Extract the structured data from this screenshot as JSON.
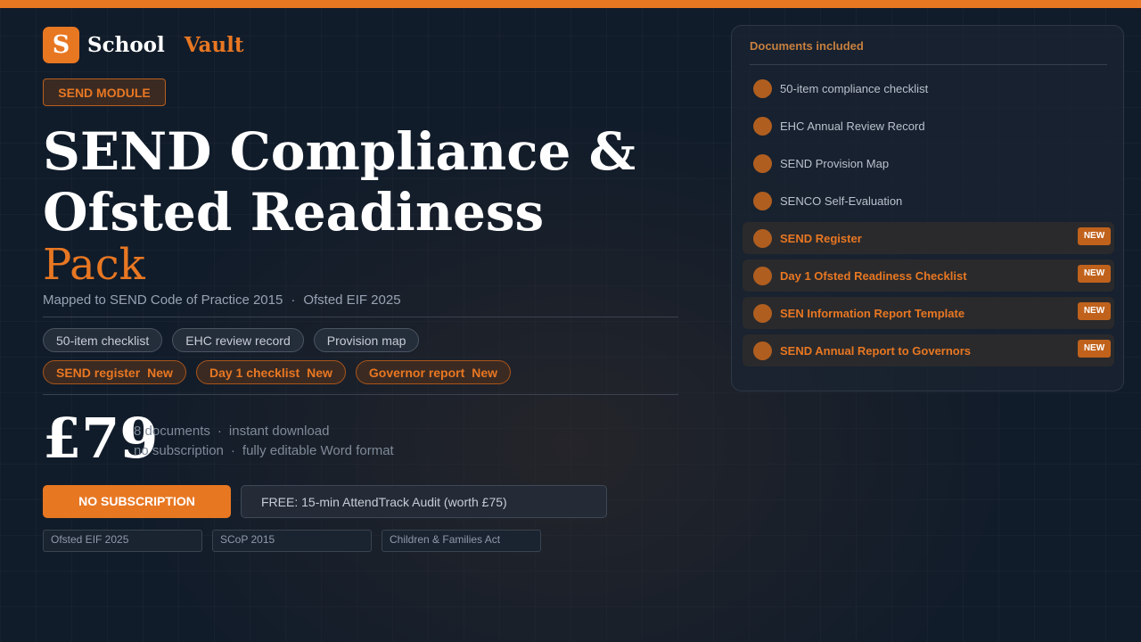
{
  "brand": {
    "logo_letter": "S",
    "name": "School",
    "accent": "Vault"
  },
  "module_badge": "SEND MODULE",
  "title": {
    "line1": "SEND Compliance &",
    "line2": "Ofsted Readiness",
    "accent": "Pack"
  },
  "mapped": {
    "part1": "Mapped to SEND Code of Practice 2015",
    "separator": "·",
    "part2": "Ofsted EIF 2025"
  },
  "chips_standard": [
    {
      "label": "50-item checklist"
    },
    {
      "label": "EHC review record"
    },
    {
      "label": "Provision map"
    }
  ],
  "chips_new": [
    {
      "label": "SEND register",
      "icon": "",
      "tag": "New"
    },
    {
      "label": "Day 1 checklist",
      "icon": "",
      "tag": "New"
    },
    {
      "label": "Governor report",
      "icon": "",
      "tag": "New"
    }
  ],
  "price": {
    "amount": "£79",
    "line1_a": "8 documents",
    "line1_b": "instant download",
    "line2_a": "no subscription",
    "line2_b": "fully editable Word format",
    "separator": "·"
  },
  "cta_label": "NO SUBSCRIPTION",
  "audit": {
    "icon": "",
    "label": "FREE: 15-min AttendTrack Audit (worth £75)"
  },
  "ref_tags": [
    "Ofsted EIF 2025",
    "SCoP 2015",
    "Children & Families Act"
  ],
  "panel": {
    "title": "Documents included",
    "documents": [
      {
        "label": "50-item compliance checklist",
        "icon": "",
        "is_new": false
      },
      {
        "label": "EHC Annual Review Record",
        "icon": "",
        "is_new": false
      },
      {
        "label": "SEND Provision Map",
        "icon": "",
        "is_new": false
      },
      {
        "label": "SENCO Self-Evaluation",
        "icon": "",
        "is_new": false
      },
      {
        "label": "SEND Register",
        "icon": "",
        "is_new": true,
        "badge": "NEW"
      },
      {
        "label": "Day 1 Ofsted Readiness Checklist",
        "icon": "",
        "is_new": true,
        "badge": "NEW"
      },
      {
        "label": "SEN Information Report Template",
        "icon": "",
        "is_new": true,
        "badge": "NEW"
      },
      {
        "label": "SEND Annual Report to Governors",
        "icon": "",
        "is_new": true,
        "badge": "NEW"
      }
    ]
  },
  "colors": {
    "accent": "#e87722",
    "background": "#111c2a"
  }
}
